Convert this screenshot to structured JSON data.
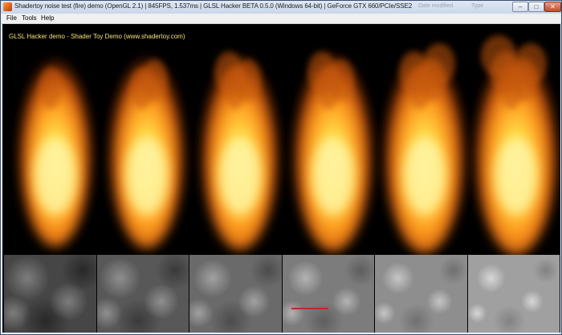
{
  "window": {
    "title": "Shadertoy noise test (fire) demo (OpenGL 2.1) | 845FPS, 1.537ms | GLSL Hacker BETA 0.5.0 (Windows 64-bit) | GeForce GTX 660/PCIe/SSE2",
    "background_labels": [
      "Date modified",
      "Type"
    ],
    "controls": {
      "minimize": "–",
      "maximize": "□",
      "close": "✕"
    }
  },
  "menu": {
    "items": [
      "File",
      "Tools",
      "Help"
    ]
  },
  "render": {
    "caption": "GLSL Hacker demo - Shader Toy Demo (www.shadertoy.com)",
    "flame_count": 6,
    "noise_tile_count": 6,
    "colors": {
      "background": "#000000",
      "flame_core": "#fff06a",
      "flame_mid": "#ff9a1e",
      "flame_edge": "#8a2a05",
      "caption": "#f7e27a"
    }
  },
  "icons": {
    "app": "fire-app-icon"
  }
}
